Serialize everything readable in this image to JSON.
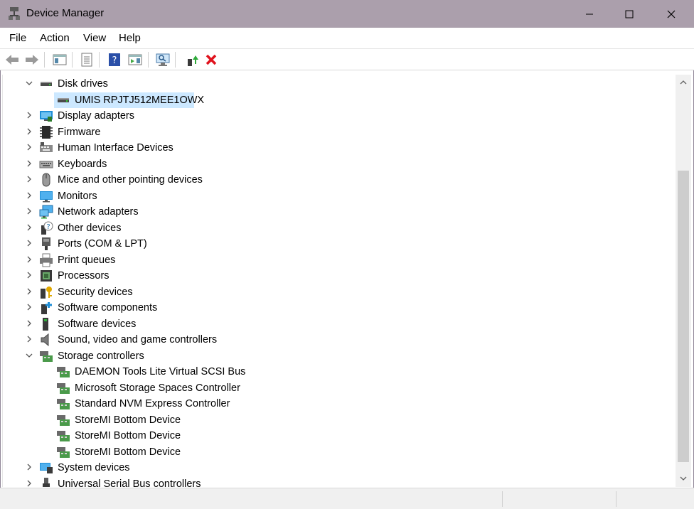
{
  "window": {
    "title": "Device Manager",
    "icon": "device-manager-icon",
    "controls": [
      "minimize-icon",
      "maximize-icon",
      "close-icon"
    ],
    "titlebar_color": "#ab9fac"
  },
  "menu": {
    "file": "File",
    "action": "Action",
    "view": "View",
    "help": "Help"
  },
  "toolbar": {
    "buttons": [
      "back-icon",
      "forward-icon",
      "show-hide-console-tree-icon",
      "properties-icon",
      "help-icon",
      "action-pane-icon",
      "scan-hardware-icon",
      "update-driver-icon",
      "uninstall-device-icon"
    ]
  },
  "tree": {
    "disk_drives": "Disk drives",
    "disk_child": "UMIS RPJTJ512MEE1OWX",
    "display_adapters": "Display adapters",
    "firmware": "Firmware",
    "hid": "Human Interface Devices",
    "keyboards": "Keyboards",
    "mice": "Mice and other pointing devices",
    "monitors": "Monitors",
    "network": "Network adapters",
    "other": "Other devices",
    "ports": "Ports (COM & LPT)",
    "print": "Print queues",
    "processors": "Processors",
    "security": "Security devices",
    "software_components": "Software components",
    "software_devices": "Software devices",
    "sound": "Sound, video and game controllers",
    "storage": "Storage controllers",
    "storage_children": [
      "DAEMON Tools Lite Virtual SCSI Bus",
      "Microsoft Storage Spaces Controller",
      "Standard NVM Express Controller",
      "StoreMI Bottom Device",
      "StoreMI Bottom Device",
      "StoreMI Bottom Device"
    ],
    "system": "System devices",
    "usb": "Universal Serial Bus controllers"
  },
  "colors": {
    "selection": "#cce8ff",
    "accent": "#0078d7"
  }
}
